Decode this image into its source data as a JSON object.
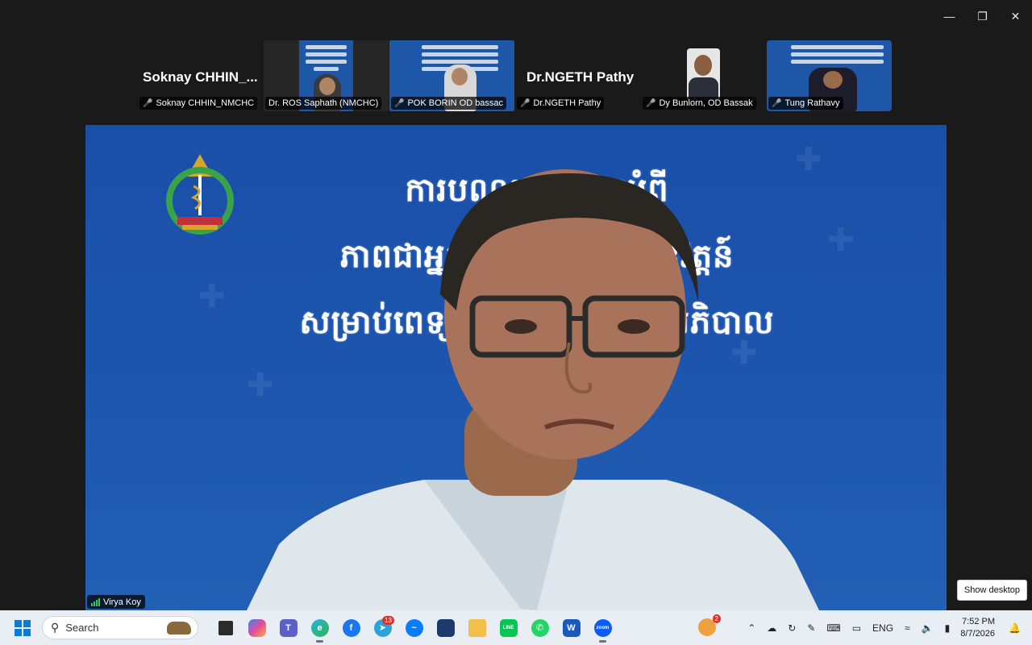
{
  "window": {
    "minimize_icon": "minimize-icon",
    "restore_icon": "restore-icon",
    "close_icon": "close-icon"
  },
  "participants": [
    {
      "name": "Soknay CHHIN_NMCHC",
      "display_name": "Soknay  CHHIN_...",
      "video": false
    },
    {
      "name": "Dr. ROS Saphath (NMCHC)",
      "video": true
    },
    {
      "name": "POK BORIN OD bassac",
      "video": true
    },
    {
      "name": "Dr.NGETH Pathy",
      "display_name": "Dr.NGETH Pathy",
      "video": false
    },
    {
      "name": "Dy Bunlorn, OD Bassak",
      "video": true
    },
    {
      "name": "Tung Rathavy",
      "video": true
    }
  ],
  "main": {
    "slide_lines": [
      "ការបណ្តុះបណ្តាលអំពី",
      "ភាពជាអ្នកដឹកនាំ និងការអនុវត្តន៍",
      "សម្រាប់ពេទ្យ និងគិលានុបដ្ឋាកអភិបាល"
    ],
    "speaker_name": "Virya Koy"
  },
  "tooltip": "Show desktop",
  "taskbar": {
    "search_placeholder": "Search",
    "apps": [
      {
        "name": "file-explorer-icon",
        "label": ""
      },
      {
        "name": "copilot-icon",
        "label": ""
      },
      {
        "name": "teams-icon",
        "label": ""
      },
      {
        "name": "edge-icon",
        "label": ""
      },
      {
        "name": "facebook-icon",
        "label": "f"
      },
      {
        "name": "telegram-icon",
        "label": "",
        "badge": "13"
      },
      {
        "name": "messenger-icon",
        "label": ""
      },
      {
        "name": "store-icon",
        "label": ""
      },
      {
        "name": "folder-icon",
        "label": ""
      },
      {
        "name": "line-icon",
        "label": "LINE"
      },
      {
        "name": "whatsapp-icon",
        "label": ""
      },
      {
        "name": "word-icon",
        "label": "W"
      },
      {
        "name": "zoom-icon",
        "label": "zoom"
      }
    ],
    "weather_badge": "2",
    "language": "ENG",
    "time": "7:52 PM",
    "date": "8/7/2026"
  },
  "colors": {
    "slide_blue": "#1d55ae",
    "taskbar_bg": "#e9eef5",
    "mic_off": "#e25050"
  }
}
